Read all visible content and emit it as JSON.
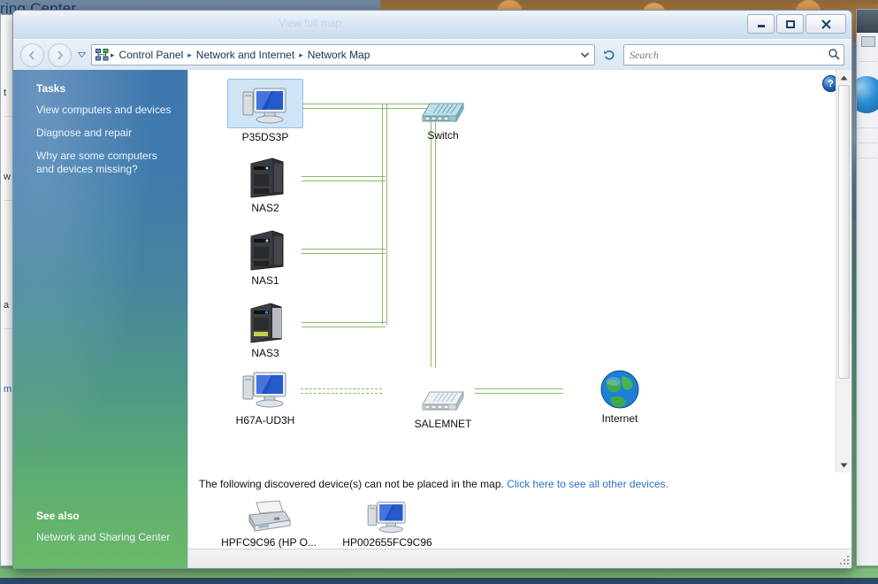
{
  "desktop": {
    "background_window_title": "ring Center",
    "left_window_fragments": [
      "t",
      "w",
      "a",
      "m"
    ]
  },
  "window": {
    "title": "View full map",
    "controls": {
      "minimize": "Minimize",
      "maximize": "Maximize",
      "close": "Close"
    }
  },
  "navigation": {
    "back_label": "Back",
    "forward_label": "Forward",
    "history_label": "Recent pages",
    "address_icon": "network-map-icon",
    "breadcrumbs": [
      "Control Panel",
      "Network and Internet",
      "Network Map"
    ],
    "breadcrumb_separator": "▸",
    "address_dropdown_label": "Previous locations",
    "refresh_label": "Refresh",
    "refresh_icon": "refresh-icon"
  },
  "search": {
    "placeholder": "Search",
    "value": "",
    "icon": "search-icon"
  },
  "sidebar": {
    "tasks_heading": "Tasks",
    "tasks": [
      "View computers and devices",
      "Diagnose and repair",
      "Why are some computers and devices missing?"
    ],
    "see_also_heading": "See also",
    "see_also": [
      "Network and Sharing Center"
    ]
  },
  "main": {
    "help_label": "?",
    "nodes": [
      {
        "id": "p35ds3p",
        "label": "P35DS3P",
        "icon": "computer-icon",
        "selected": true
      },
      {
        "id": "switch",
        "label": "Switch",
        "icon": "switch-icon",
        "selected": false
      },
      {
        "id": "nas2",
        "label": "NAS2",
        "icon": "nas-icon",
        "selected": false
      },
      {
        "id": "nas1",
        "label": "NAS1",
        "icon": "nas-icon",
        "selected": false
      },
      {
        "id": "nas3",
        "label": "NAS3",
        "icon": "nas-light-icon",
        "selected": false
      },
      {
        "id": "h67a",
        "label": "H67A-UD3H",
        "icon": "computer-icon",
        "selected": false
      },
      {
        "id": "salemnet",
        "label": "SALEMNET",
        "icon": "router-icon",
        "selected": false
      },
      {
        "id": "internet",
        "label": "Internet",
        "icon": "globe-icon",
        "selected": false
      }
    ],
    "notice_text": "The following discovered device(s) can not be placed in the map.",
    "notice_link": "Click here to see all other devices.",
    "unplaced_devices": [
      {
        "label": "HPFC9C96 (HP O...",
        "icon": "printer-icon"
      },
      {
        "label": "HP002655FC9C96",
        "icon": "computer-icon"
      }
    ],
    "connection_color": "#8aba6a"
  },
  "scrollbar": {
    "up_label": "Scroll up",
    "down_label": "Scroll down"
  },
  "status": {
    "resize_grip": "Resize"
  }
}
